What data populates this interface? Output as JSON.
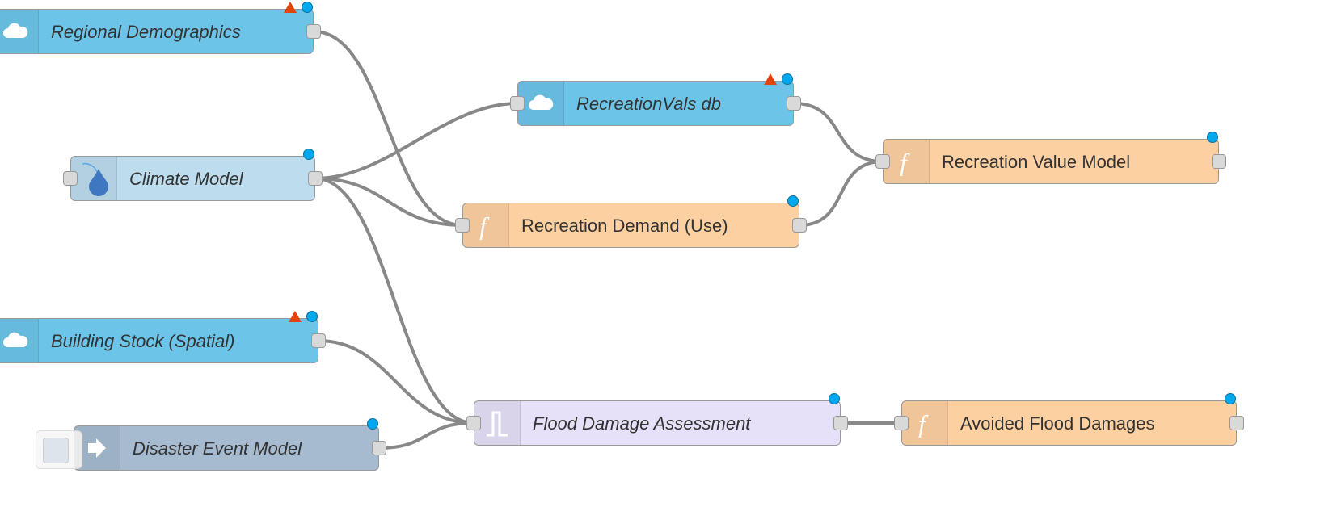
{
  "colors": {
    "database": "#6cc5e8",
    "climate": "#bddcee",
    "function": "#fdd0a2",
    "switch": "#e6e0f8",
    "inject": "#a6bbcf",
    "wire": "#888888",
    "status_dot": "#00a8ef",
    "warning": "#e2440b"
  },
  "nodes": [
    {
      "id": "rd",
      "label": "Regional Demographics",
      "icon": "cloud-db-icon",
      "type": "database",
      "warning": true,
      "status": true,
      "input": false,
      "output": true
    },
    {
      "id": "cm",
      "label": "Climate Model",
      "icon": "water-drop-icon",
      "type": "climate",
      "warning": false,
      "status": true,
      "input": true,
      "output": true
    },
    {
      "id": "rv",
      "label": "RecreationVals db",
      "icon": "cloud-db-icon",
      "type": "database",
      "warning": true,
      "status": true,
      "input": true,
      "output": true
    },
    {
      "id": "rdu",
      "label": "Recreation Demand (Use)",
      "icon": "function-icon",
      "type": "function",
      "warning": false,
      "status": true,
      "input": true,
      "output": true
    },
    {
      "id": "rvm",
      "label": "Recreation Value Model",
      "icon": "function-icon",
      "type": "function",
      "warning": false,
      "status": true,
      "input": true,
      "output": true
    },
    {
      "id": "bs",
      "label": "Building Stock (Spatial)",
      "icon": "cloud-db-icon",
      "type": "database",
      "warning": true,
      "status": true,
      "input": false,
      "output": true
    },
    {
      "id": "de",
      "label": "Disaster Event Model",
      "icon": "inject-arrow-icon",
      "type": "inject",
      "warning": false,
      "status": true,
      "input": false,
      "output": true
    },
    {
      "id": "fd",
      "label": "Flood Damage Assessment",
      "icon": "switch-pulse-icon",
      "type": "switch",
      "warning": false,
      "status": true,
      "input": true,
      "output": true
    },
    {
      "id": "af",
      "label": "Avoided Flood Damages",
      "icon": "function-icon",
      "type": "function",
      "warning": false,
      "status": true,
      "input": true,
      "output": true
    }
  ],
  "wires": [
    [
      "rd",
      "rdu"
    ],
    [
      "cm",
      "rv"
    ],
    [
      "cm",
      "rdu"
    ],
    [
      "cm",
      "fd"
    ],
    [
      "rv",
      "rvm"
    ],
    [
      "rdu",
      "rvm"
    ],
    [
      "bs",
      "fd"
    ],
    [
      "de",
      "fd"
    ],
    [
      "fd",
      "af"
    ]
  ]
}
